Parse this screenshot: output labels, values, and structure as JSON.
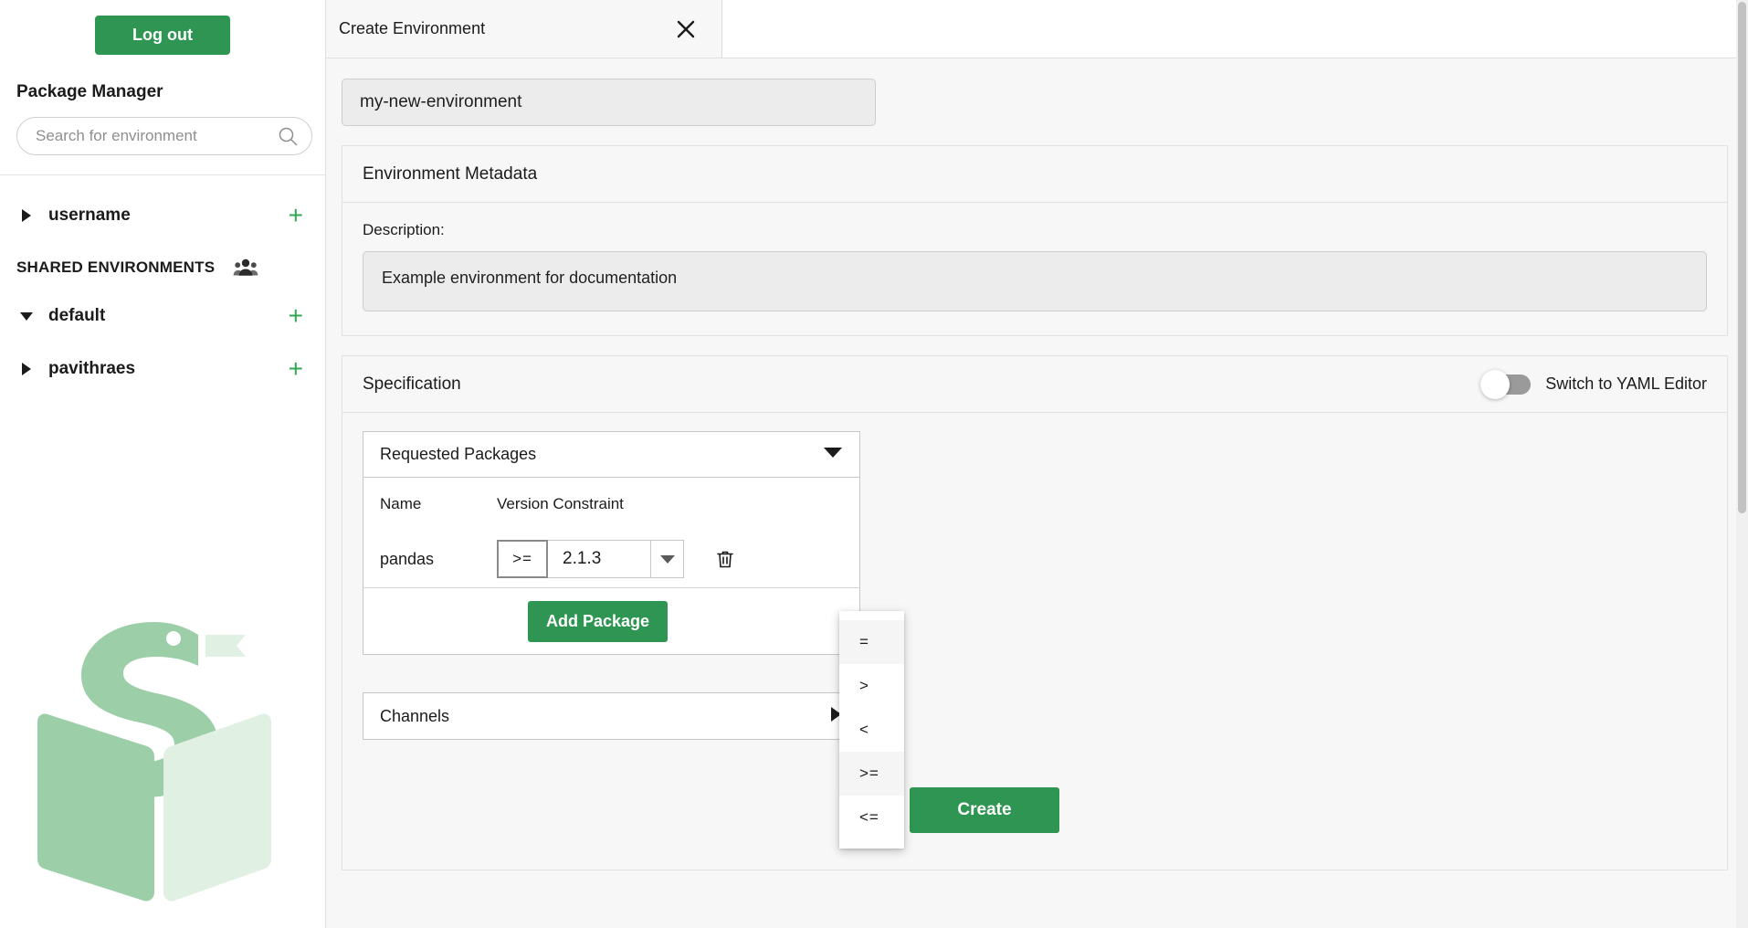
{
  "sidebar": {
    "logout_label": "Log out",
    "app_title": "Package Manager",
    "search": {
      "placeholder": "Search for environment",
      "value": "",
      "icon": "search-icon"
    },
    "user_namespace": {
      "label": "username",
      "expanded": false,
      "add_label": "+"
    },
    "shared_section": {
      "label": "SHARED ENVIRONMENTS",
      "icon": "people-group-icon"
    },
    "namespaces": [
      {
        "label": "default",
        "expanded": true,
        "add_label": "+"
      },
      {
        "label": "pavithraes",
        "expanded": false,
        "add_label": "+"
      }
    ],
    "logo": {
      "name": "conda-store-logo",
      "color_dark": "#9ccfa8",
      "color_light": "#e0f0e3"
    }
  },
  "tab": {
    "title": "Create Environment",
    "close_icon": "close-icon"
  },
  "environment": {
    "name_value": "my-new-environment"
  },
  "metadata_card": {
    "title": "Environment Metadata",
    "description_label": "Description:",
    "description_value": "Example environment for documentation"
  },
  "specification_card": {
    "title": "Specification",
    "yaml_toggle": {
      "label": "Switch to YAML Editor",
      "enabled": false
    },
    "requested_packages": {
      "title": "Requested Packages",
      "expanded": true,
      "chevron_icon": "chevron-down-icon",
      "columns": [
        "Name",
        "Version Constraint"
      ],
      "rows": [
        {
          "name": "pandas",
          "operator": "&gt;=",
          "version": "2.1.3",
          "version_chevron_icon": "chevron-down-icon",
          "delete_icon": "trash-icon"
        }
      ],
      "add_button_label": "Add Package"
    },
    "operator_menu": {
      "open": true,
      "items": [
        {
          "label": "=",
          "highlighted": true
        },
        {
          "label": "&gt;",
          "highlighted": false
        },
        {
          "label": "&lt;",
          "highlighted": false
        },
        {
          "label": "&gt;=",
          "highlighted": true
        },
        {
          "label": "&lt;=",
          "highlighted": false
        }
      ]
    },
    "channels": {
      "title": "Channels",
      "expanded": false,
      "chevron_icon": "chevron-right-icon"
    }
  },
  "actions": {
    "create_label": "Create"
  },
  "colors": {
    "brand_green": "#2e9652",
    "plus_green": "#33a853",
    "page_bg": "#f7f7f7"
  }
}
